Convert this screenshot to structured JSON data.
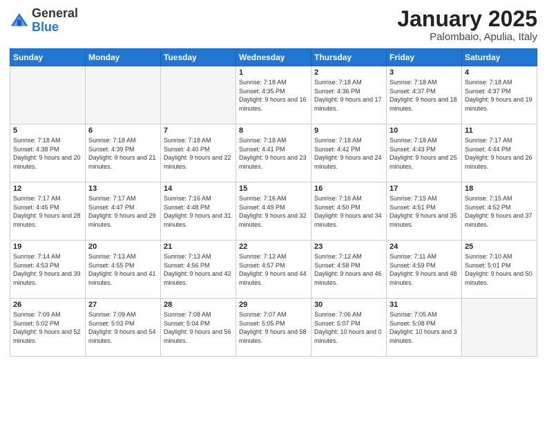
{
  "header": {
    "logo_general": "General",
    "logo_blue": "Blue",
    "month": "January 2025",
    "location": "Palombaio, Apulia, Italy"
  },
  "days_of_week": [
    "Sunday",
    "Monday",
    "Tuesday",
    "Wednesday",
    "Thursday",
    "Friday",
    "Saturday"
  ],
  "weeks": [
    [
      {
        "day": "",
        "empty": true
      },
      {
        "day": "",
        "empty": true
      },
      {
        "day": "",
        "empty": true
      },
      {
        "day": "1",
        "sunrise": "7:18 AM",
        "sunset": "4:35 PM",
        "daylight": "9 hours and 16 minutes."
      },
      {
        "day": "2",
        "sunrise": "7:18 AM",
        "sunset": "4:36 PM",
        "daylight": "9 hours and 17 minutes."
      },
      {
        "day": "3",
        "sunrise": "7:18 AM",
        "sunset": "4:37 PM",
        "daylight": "9 hours and 18 minutes."
      },
      {
        "day": "4",
        "sunrise": "7:18 AM",
        "sunset": "4:37 PM",
        "daylight": "9 hours and 19 minutes."
      }
    ],
    [
      {
        "day": "5",
        "sunrise": "7:18 AM",
        "sunset": "4:38 PM",
        "daylight": "9 hours and 20 minutes."
      },
      {
        "day": "6",
        "sunrise": "7:18 AM",
        "sunset": "4:39 PM",
        "daylight": "9 hours and 21 minutes."
      },
      {
        "day": "7",
        "sunrise": "7:18 AM",
        "sunset": "4:40 PM",
        "daylight": "9 hours and 22 minutes."
      },
      {
        "day": "8",
        "sunrise": "7:18 AM",
        "sunset": "4:41 PM",
        "daylight": "9 hours and 23 minutes."
      },
      {
        "day": "9",
        "sunrise": "7:18 AM",
        "sunset": "4:42 PM",
        "daylight": "9 hours and 24 minutes."
      },
      {
        "day": "10",
        "sunrise": "7:18 AM",
        "sunset": "4:43 PM",
        "daylight": "9 hours and 25 minutes."
      },
      {
        "day": "11",
        "sunrise": "7:17 AM",
        "sunset": "4:44 PM",
        "daylight": "9 hours and 26 minutes."
      }
    ],
    [
      {
        "day": "12",
        "sunrise": "7:17 AM",
        "sunset": "4:45 PM",
        "daylight": "9 hours and 28 minutes."
      },
      {
        "day": "13",
        "sunrise": "7:17 AM",
        "sunset": "4:47 PM",
        "daylight": "9 hours and 29 minutes."
      },
      {
        "day": "14",
        "sunrise": "7:16 AM",
        "sunset": "4:48 PM",
        "daylight": "9 hours and 31 minutes."
      },
      {
        "day": "15",
        "sunrise": "7:16 AM",
        "sunset": "4:49 PM",
        "daylight": "9 hours and 32 minutes."
      },
      {
        "day": "16",
        "sunrise": "7:16 AM",
        "sunset": "4:50 PM",
        "daylight": "9 hours and 34 minutes."
      },
      {
        "day": "17",
        "sunrise": "7:15 AM",
        "sunset": "4:51 PM",
        "daylight": "9 hours and 35 minutes."
      },
      {
        "day": "18",
        "sunrise": "7:15 AM",
        "sunset": "4:52 PM",
        "daylight": "9 hours and 37 minutes."
      }
    ],
    [
      {
        "day": "19",
        "sunrise": "7:14 AM",
        "sunset": "4:53 PM",
        "daylight": "9 hours and 39 minutes."
      },
      {
        "day": "20",
        "sunrise": "7:13 AM",
        "sunset": "4:55 PM",
        "daylight": "9 hours and 41 minutes."
      },
      {
        "day": "21",
        "sunrise": "7:13 AM",
        "sunset": "4:56 PM",
        "daylight": "9 hours and 42 minutes."
      },
      {
        "day": "22",
        "sunrise": "7:12 AM",
        "sunset": "4:57 PM",
        "daylight": "9 hours and 44 minutes."
      },
      {
        "day": "23",
        "sunrise": "7:12 AM",
        "sunset": "4:58 PM",
        "daylight": "9 hours and 46 minutes."
      },
      {
        "day": "24",
        "sunrise": "7:11 AM",
        "sunset": "4:59 PM",
        "daylight": "9 hours and 48 minutes."
      },
      {
        "day": "25",
        "sunrise": "7:10 AM",
        "sunset": "5:01 PM",
        "daylight": "9 hours and 50 minutes."
      }
    ],
    [
      {
        "day": "26",
        "sunrise": "7:09 AM",
        "sunset": "5:02 PM",
        "daylight": "9 hours and 52 minutes."
      },
      {
        "day": "27",
        "sunrise": "7:09 AM",
        "sunset": "5:03 PM",
        "daylight": "9 hours and 54 minutes."
      },
      {
        "day": "28",
        "sunrise": "7:08 AM",
        "sunset": "5:04 PM",
        "daylight": "9 hours and 56 minutes."
      },
      {
        "day": "29",
        "sunrise": "7:07 AM",
        "sunset": "5:05 PM",
        "daylight": "9 hours and 58 minutes."
      },
      {
        "day": "30",
        "sunrise": "7:06 AM",
        "sunset": "5:07 PM",
        "daylight": "10 hours and 0 minutes."
      },
      {
        "day": "31",
        "sunrise": "7:05 AM",
        "sunset": "5:08 PM",
        "daylight": "10 hours and 3 minutes."
      },
      {
        "day": "",
        "empty": true
      }
    ]
  ]
}
